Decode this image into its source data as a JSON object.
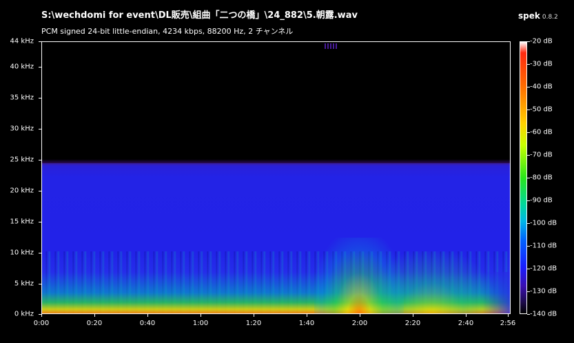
{
  "header": {
    "file_path": "S:\\wechdomi for event\\DL販売\\組曲「二つの橋」\\24_882\\5.朝露.wav",
    "format_info": "PCM signed 24-bit little-endian, 4234 kbps, 88200 Hz, 2 チャンネル",
    "app_name": "spek",
    "app_version": "0.8.2"
  },
  "axes": {
    "frequency_ticks": [
      "44 kHz",
      "40 kHz",
      "35 kHz",
      "30 kHz",
      "25 kHz",
      "20 kHz",
      "15 kHz",
      "10 kHz",
      "5 kHz",
      "0 kHz"
    ],
    "time_ticks": [
      "0:00",
      "0:20",
      "0:40",
      "1:00",
      "1:20",
      "1:40",
      "2:00",
      "2:20",
      "2:40",
      "2:56"
    ],
    "db_ticks": [
      "-20 dB",
      "-30 dB",
      "-40 dB",
      "-50 dB",
      "-60 dB",
      "-70 dB",
      "-80 dB",
      "-90 dB",
      "-100 dB",
      "-110 dB",
      "-120 dB",
      "-130 dB",
      "-140 dB"
    ]
  },
  "spectrogram": {
    "frequency_range_khz": [
      0,
      44
    ],
    "time_range_seconds": [
      0,
      176
    ],
    "db_range": [
      -140,
      -20
    ],
    "content_cutoff_khz": 25
  }
}
